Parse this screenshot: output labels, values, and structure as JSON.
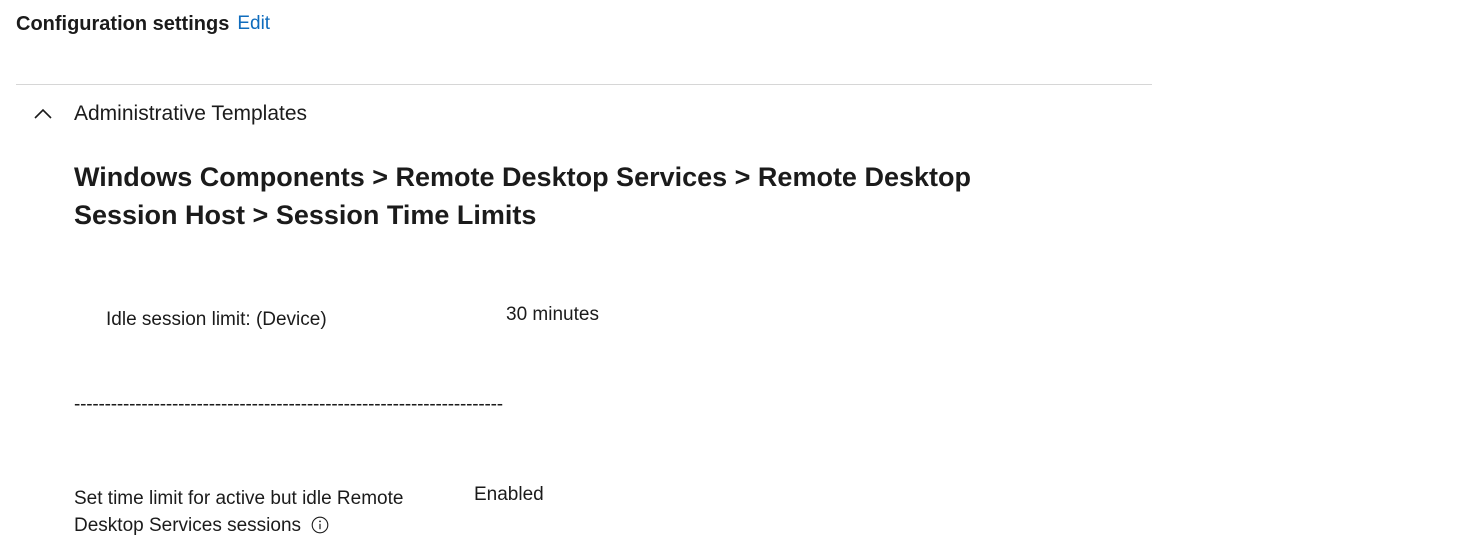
{
  "header": {
    "title": "Configuration settings",
    "edit_label": "Edit"
  },
  "section": {
    "label": "Administrative Templates",
    "expanded": true,
    "chevron_icon": "chevron-up-icon"
  },
  "category_path": "Windows Components > Remote Desktop Services > Remote Desktop Session Host > Session Time Limits",
  "settings": [
    {
      "label": "Idle session limit: (Device)",
      "value": "30 minutes"
    },
    {
      "separator": "----------------------------------------------------------------------"
    },
    {
      "label": "Set time limit for active but idle Remote Desktop Services sessions",
      "value": "Enabled",
      "info_icon": "info-icon"
    }
  ],
  "colors": {
    "link": "#0f6cbd",
    "text": "#1b1b1b",
    "divider": "#d6d6d6"
  }
}
